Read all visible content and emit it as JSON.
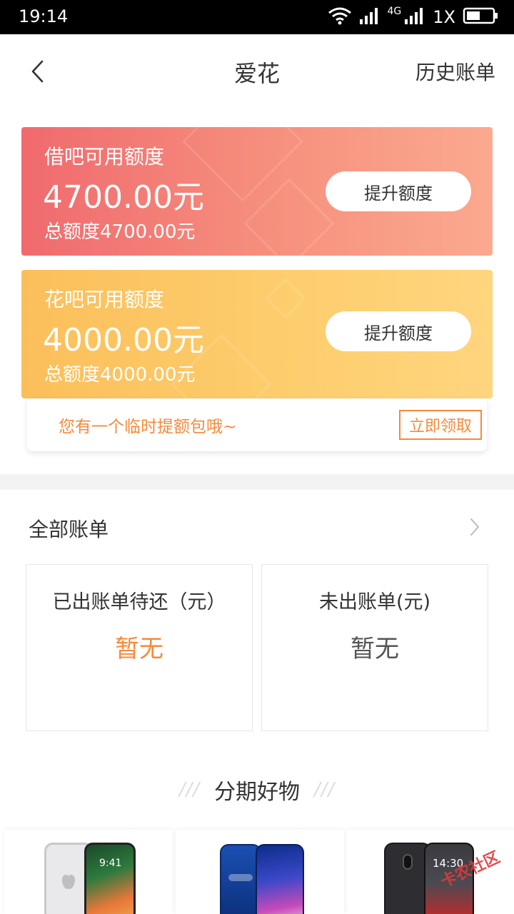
{
  "status_bar": {
    "time": "19:14",
    "network_small": "4G",
    "network": "1X"
  },
  "header": {
    "title": "爱花",
    "history_link": "历史账单"
  },
  "cards": [
    {
      "label": "借吧可用额度",
      "amount": "4700.00元",
      "total": "总额度4700.00元",
      "button": "提升额度",
      "accent": "#f06a6e"
    },
    {
      "label": "花吧可用额度",
      "amount": "4000.00元",
      "total": "总额度4000.00元",
      "button": "提升额度",
      "accent": "#fbbf5a"
    }
  ],
  "temp_quota": {
    "text": "您有一个临时提额包哦~",
    "button": "立即领取",
    "accent": "#f58a3b"
  },
  "bills": {
    "title": "全部账单",
    "items": [
      {
        "label": "已出账单待还（元）",
        "value": "暂无"
      },
      {
        "label": "未出账单(元)",
        "value": "暂无"
      }
    ]
  },
  "goods": {
    "title": "分期好物",
    "deco_left": "///",
    "deco_right": "///",
    "phone_screens": [
      "9:41",
      "",
      "14:30"
    ]
  },
  "watermark": "卡农社区"
}
